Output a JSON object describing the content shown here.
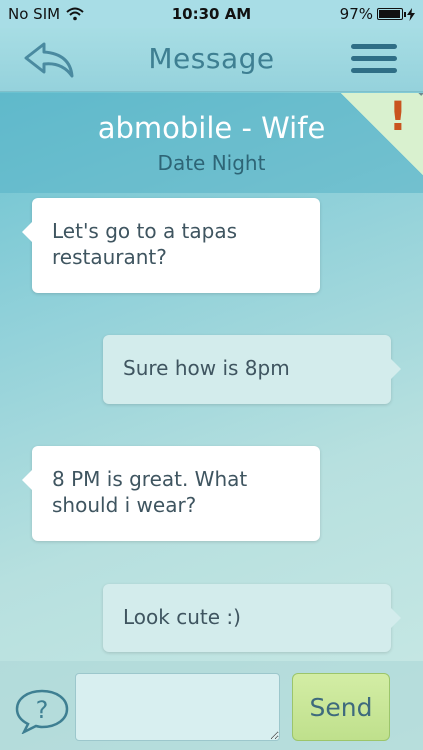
{
  "status_bar": {
    "carrier": "No SIM",
    "wifi_icon": "wifi-icon",
    "time": "10:30 AM",
    "battery_percent": "97%",
    "battery_level": 0.97,
    "charging_icon": "lightning-icon"
  },
  "nav": {
    "back_icon": "back-arrow-icon",
    "title": "Message",
    "menu_icon": "hamburger-menu-icon"
  },
  "conversation": {
    "title": "abmobile - Wife",
    "subtitle": "Date Night",
    "alert_icon": "exclamation-icon",
    "alert_glyph": "!"
  },
  "messages": [
    {
      "direction": "incoming",
      "text": "Let's go to a tapas restaurant?"
    },
    {
      "direction": "outgoing",
      "text": "Sure how is 8pm"
    },
    {
      "direction": "incoming",
      "text": "8 PM is great. What should i wear?"
    },
    {
      "direction": "outgoing",
      "text": "Look cute :)"
    }
  ],
  "composer": {
    "help_icon": "help-question-icon",
    "help_glyph": "?",
    "input_value": "",
    "input_placeholder": "",
    "send_label": "Send"
  },
  "colors": {
    "accent": "#3e7f92",
    "send_button": "#c9e59b",
    "alert": "#c9541f",
    "incoming_bubble": "#ffffff",
    "outgoing_bubble": "#d3ecec"
  }
}
